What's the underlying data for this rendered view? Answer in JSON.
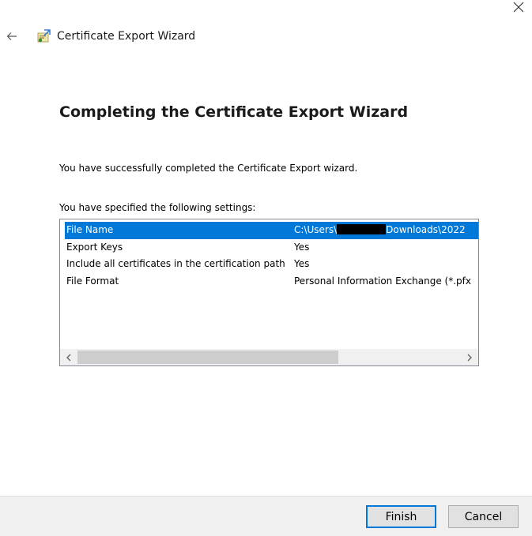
{
  "window": {
    "title": "Certificate Export Wizard"
  },
  "page": {
    "heading": "Completing the Certificate Export Wizard",
    "success_text": "You have successfully completed the Certificate Export wizard.",
    "settings_label": "You have specified the following settings:"
  },
  "settings": [
    {
      "name": "File Name",
      "value_prefix": "C:\\Users\\",
      "value_suffix": "Downloads\\2022",
      "redacted": true,
      "selected": true
    },
    {
      "name": "Export Keys",
      "value": "Yes"
    },
    {
      "name": "Include all certificates in the certification path",
      "value": "Yes"
    },
    {
      "name": "File Format",
      "value": "Personal Information Exchange (*.pfx"
    }
  ],
  "buttons": {
    "finish": "Finish",
    "cancel": "Cancel"
  },
  "colors": {
    "selection": "#0078d7",
    "footer": "#f0f0f0"
  }
}
